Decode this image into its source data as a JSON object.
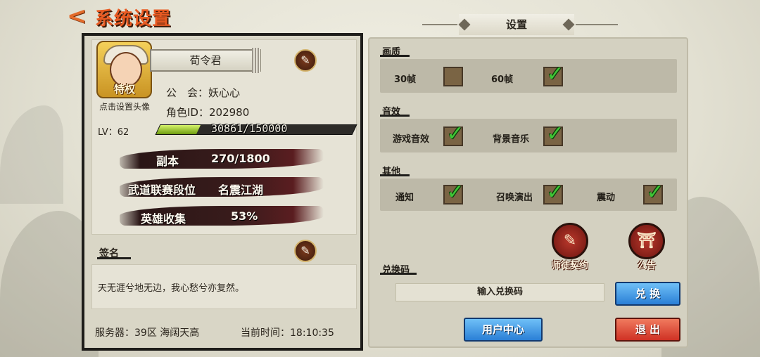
{
  "header": {
    "back_glyph": "<",
    "title": "系统设置",
    "tab_title": "设置"
  },
  "profile": {
    "avatar_badge": "特权",
    "avatar_caption": "点击设置头像",
    "name": "荀令君",
    "guild_label": "公　会：",
    "guild_value": "妖心心",
    "role_id_label": "角色ID：",
    "role_id_value": "202980",
    "level_label": "LV：62",
    "exp_text": "30861/150000",
    "exp_fraction": 0.2057,
    "stats": [
      {
        "label": "副本",
        "value": "270/1800"
      },
      {
        "label": "武道联赛段位",
        "value": "名震江湖"
      },
      {
        "label": "英雄收集",
        "value": "53%"
      }
    ]
  },
  "signature": {
    "label": "签名",
    "text": "天无涯兮地无边，我心愁兮亦复然。"
  },
  "footer": {
    "server_text": "服务器：39区 海阔天高",
    "time_text": "当前时间：18:10:35"
  },
  "settings": {
    "graphics": {
      "label": "画质",
      "options": [
        {
          "label": "30帧",
          "checked": false
        },
        {
          "label": "60帧",
          "checked": true
        }
      ]
    },
    "sound": {
      "label": "音效",
      "options": [
        {
          "label": "游戏音效",
          "checked": true
        },
        {
          "label": "背景音乐",
          "checked": true
        }
      ]
    },
    "other": {
      "label": "其他",
      "options": [
        {
          "label": "通知",
          "checked": true
        },
        {
          "label": "召唤演出",
          "checked": true
        },
        {
          "label": "震动",
          "checked": true
        }
      ]
    }
  },
  "actions": {
    "mentor_label": "师徒契约",
    "notice_label": "公告",
    "redeem_label": "兑换码",
    "redeem_placeholder": "输入兑换码",
    "redeem_button": "兑 换",
    "user_center_button": "用户中心",
    "logout_button": "退 出"
  },
  "icons": {
    "brush": "brush-icon",
    "check": "✓",
    "mentor": "✎",
    "notice": "⛩"
  },
  "colors": {
    "accent_orange": "#e85a22",
    "check_green": "#3fc436",
    "button_blue": "#2a7fd6",
    "button_red": "#cf3124"
  }
}
